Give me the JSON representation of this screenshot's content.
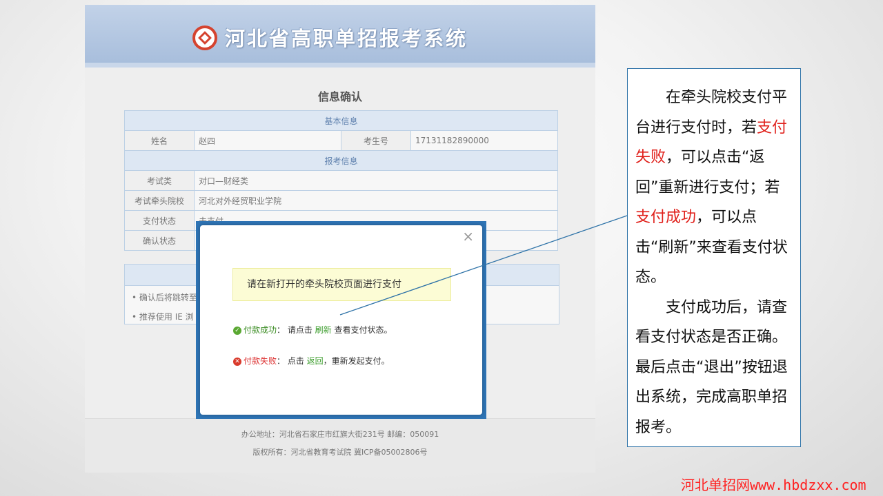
{
  "header": {
    "title": "河北省高职单招报考系统"
  },
  "page_heading": "信息确认",
  "info": {
    "basic_section": "基本信息",
    "name_label": "姓名",
    "name_value": "赵四",
    "exam_no_label": "考生号",
    "exam_no_value": "17131182890000",
    "apply_section": "报考信息",
    "exam_type_label": "考试类",
    "exam_type_value": "对口—财经类",
    "school_label": "考试牵头院校",
    "school_value": "河北对外经贸职业学院",
    "pay_status_label": "支付状态",
    "pay_status_value": "未支付",
    "confirm_status_label": "确认状态"
  },
  "tips": [
    "• 确认后将跳转至",
    "• 推荐使用 IE 浏"
  ],
  "footer": {
    "address": "办公地址：河北省石家庄市红旗大街231号    邮编：050091",
    "copyright": "版权所有：河北省教育考试院 冀ICP备05002806号"
  },
  "dialog": {
    "close": "×",
    "notice": "请在新打开的牵头院校页面进行支付",
    "success_label": "付款成功",
    "success_text1": "：  请点击 ",
    "success_link": "刷新",
    "success_text2": " 查看支付状态。",
    "fail_label": "付款失败",
    "fail_text1": "：  点击 ",
    "fail_link": "返回",
    "fail_text2": "，重新发起支付。"
  },
  "callout": {
    "p1_a": "在牵头院校支付平台进行支付时，若",
    "p1_red1": "支付失败",
    "p1_b": "，可以点击“返回”重新进行支付；若",
    "p1_red2": "支付成功",
    "p1_c": "，可以点击“刷新”来查看支付状态。",
    "p2": "支付成功后，请查看支付状态是否正确。最后点击“退出”按钮退出系统，完成高职单招报考。",
    "accent_color": "#e0201b"
  },
  "watermark": "河北单招网www.hbdzxx.com"
}
